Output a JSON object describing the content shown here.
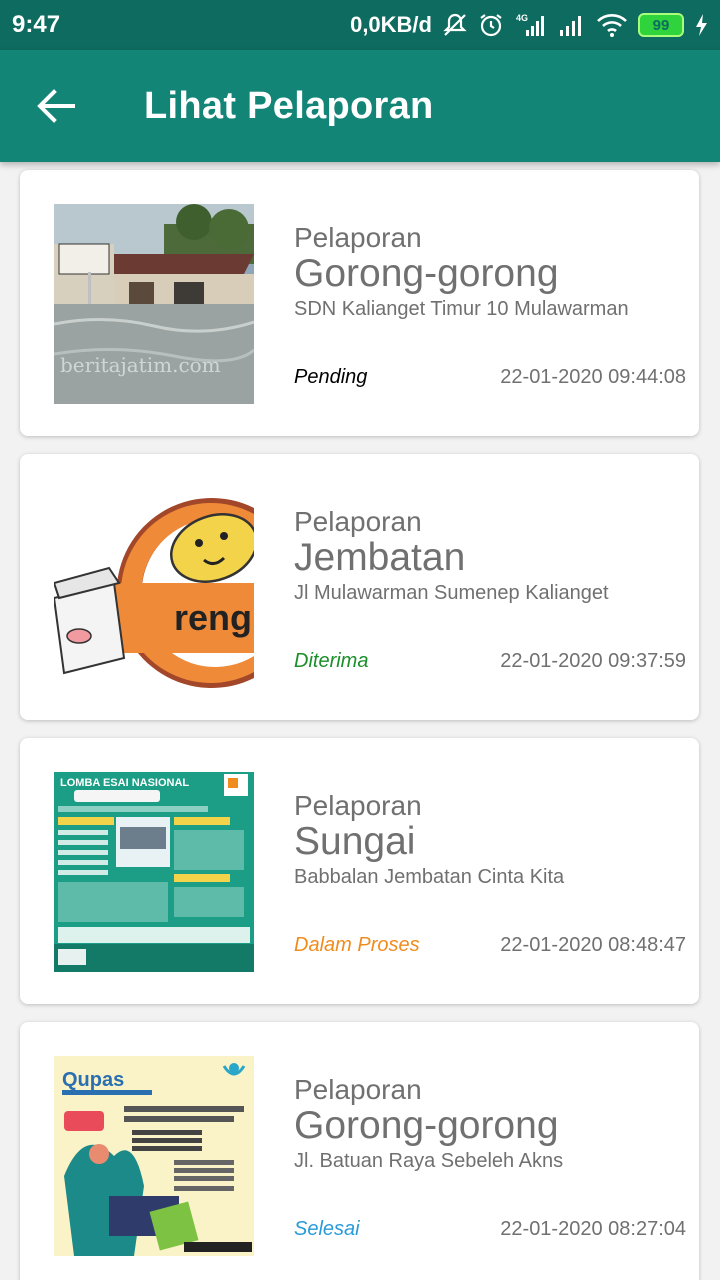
{
  "statusbar": {
    "time": "9:47",
    "network_speed": "0,0KB/d",
    "signal_label": "4G",
    "battery": "99",
    "icons": [
      "mute-icon",
      "alarm-icon",
      "signal-icon",
      "wifi-icon",
      "battery-icon",
      "charging-icon"
    ]
  },
  "appbar": {
    "title": "Lihat Pelaporan",
    "back_icon": "arrow-left-icon"
  },
  "colors": {
    "appbar": "#138577",
    "statusbar": "#0e6b5f",
    "pending": "#000000",
    "diterima": "#1a8f2a",
    "dalam_proses": "#f08c1e",
    "selesai": "#2a9ad8",
    "text_gray": "#707070"
  },
  "reports": [
    {
      "category": "Pelaporan",
      "type": "Gorong-gorong",
      "location": "SDN Kalianget Timur 10 Mulawarman",
      "status": "Pending",
      "status_color": "#000000",
      "datetime": "22-01-2020 09:44:08",
      "thumb_text": "beritajatim.com"
    },
    {
      "category": "Pelaporan",
      "type": "Jembatan",
      "location": "Jl Mulawarman Sumenep Kalianget",
      "status": "Diterima",
      "status_color": "#1a8f2a",
      "datetime": "22-01-2020 09:37:59",
      "thumb_text": "reng"
    },
    {
      "category": "Pelaporan",
      "type": "Sungai",
      "location": "Babbalan Jembatan Cinta Kita",
      "status": "Dalam Proses",
      "status_color": "#f08c1e",
      "datetime": "22-01-2020 08:48:47",
      "thumb_text": "LOMBA ESAI NASIONAL"
    },
    {
      "category": "Pelaporan",
      "type": "Gorong-gorong",
      "location": "Jl. Batuan Raya Sebeleh Akns",
      "status": "Selesai",
      "status_color": "#2a9ad8",
      "datetime": "22-01-2020 08:27:04",
      "thumb_text": "Qupas"
    }
  ]
}
